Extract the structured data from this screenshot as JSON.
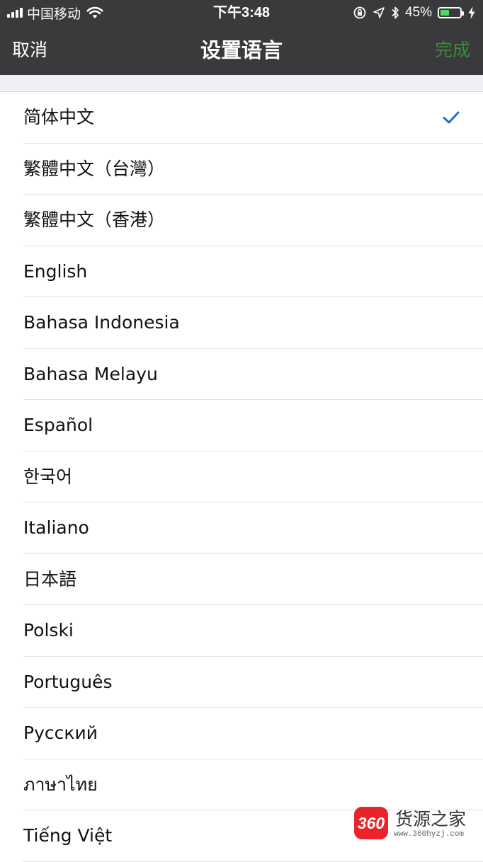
{
  "status_bar": {
    "carrier": "中国移动",
    "time": "下午3:48",
    "battery_percent": "45%",
    "battery_level": 0.45,
    "icons": [
      "signal-icon",
      "wifi-icon",
      "orientation-lock-icon",
      "location-icon",
      "bluetooth-icon",
      "battery-icon",
      "charging-icon"
    ]
  },
  "nav": {
    "cancel_label": "取消",
    "title": "设置语言",
    "done_label": "完成"
  },
  "languages": [
    {
      "label": "简体中文",
      "selected": true
    },
    {
      "label": "繁體中文（台灣）",
      "selected": false
    },
    {
      "label": "繁體中文（香港）",
      "selected": false
    },
    {
      "label": "English",
      "selected": false
    },
    {
      "label": "Bahasa Indonesia",
      "selected": false
    },
    {
      "label": "Bahasa Melayu",
      "selected": false
    },
    {
      "label": "Español",
      "selected": false
    },
    {
      "label": "한국어",
      "selected": false
    },
    {
      "label": "Italiano",
      "selected": false
    },
    {
      "label": "日本語",
      "selected": false
    },
    {
      "label": "Polski",
      "selected": false
    },
    {
      "label": "Português",
      "selected": false
    },
    {
      "label": "Русский",
      "selected": false
    },
    {
      "label": "ภาษาไทย",
      "selected": false
    },
    {
      "label": "Tiếng Việt",
      "selected": false
    }
  ],
  "colors": {
    "nav_background": "#3a3a3d",
    "done_text": "#3d8a3a",
    "checkmark": "#1a73c9",
    "battery_fill": "#4cd964",
    "watermark_red": "#e8232a"
  },
  "watermark": {
    "badge": "360",
    "name": "货源之家",
    "url": "www.360hyzj.com"
  }
}
